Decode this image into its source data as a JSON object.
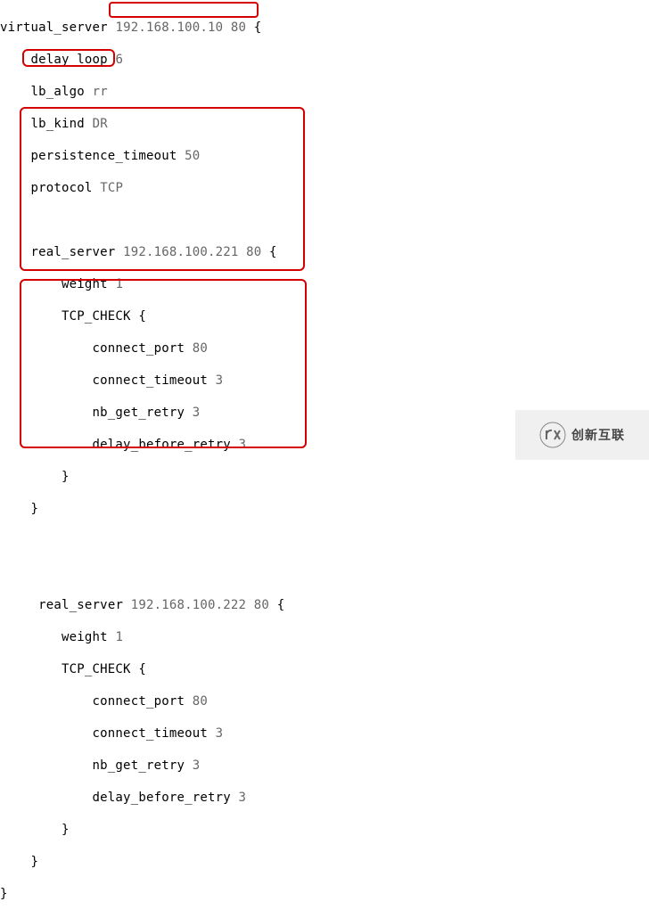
{
  "config": {
    "virtual_server_ip": "192.168.100.10",
    "virtual_server_port": "80",
    "delay_loop": "6",
    "lb_algo": "rr",
    "lb_kind": "DR",
    "persistence_timeout": "50",
    "protocol": "TCP",
    "servers": [
      {
        "ip": "192.168.100.221",
        "port": "80",
        "weight": "1",
        "connect_port": "80",
        "connect_timeout": "3",
        "nb_get_retry": "3",
        "delay_before_retry": "3"
      },
      {
        "ip": "192.168.100.222",
        "port": "80",
        "weight": "1",
        "connect_port": "80",
        "connect_timeout": "3",
        "nb_get_retry": "3",
        "delay_before_retry": "3"
      }
    ]
  },
  "labels": {
    "virtual_server": "virtual_server",
    "delay_loop": "delay_loop",
    "lb_algo": "lb_algo",
    "lb_kind": "lb_kind",
    "persistence_timeout": "persistence_timeout",
    "protocol": "protocol",
    "real_server": "real_server",
    "weight": "weight",
    "tcp_check": "TCP_CHECK",
    "connect_port": "connect_port",
    "connect_timeout": "connect_timeout",
    "nb_get_retry": "nb_get_retry",
    "delay_before_retry": "delay_before_retry"
  },
  "watermark": {
    "text": "创新互联",
    "icon_name": "cx-logo"
  }
}
